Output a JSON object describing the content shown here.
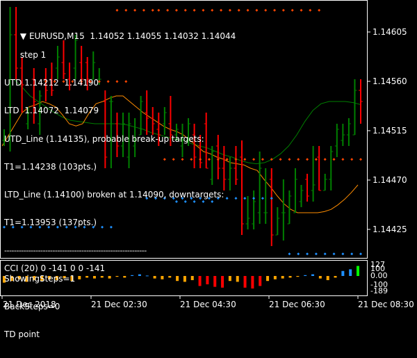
{
  "header": {
    "symbol_line": "EURUSD,M15  1.14052 1.14055 1.14032 1.14044",
    "lines": [
      "step 1",
      "UTD 1.14212  1.14190",
      "LTD  1.14072  1.14079",
      "UTD_Line (1.14135), probable break-up targets:",
      "T1=1.14238 (103pts.)",
      "LTD_Line (1.14100) broken at 1.14090, downtargets:",
      "T1=1.13953 (137pts.)",
      "ShowingSteps=1",
      "BackSteps=0",
      "TD point"
    ]
  },
  "cci": {
    "title": "CCI (20) 0 -141 0 0 -141",
    "levels": [
      "127",
      "100",
      "0.00",
      "-100",
      "-189"
    ]
  },
  "price_axis": [
    "1.14605",
    "1.14560",
    "1.14515",
    "1.14470",
    "1.14425"
  ],
  "time_axis": [
    "21 Dec 2018",
    "21 Dec 02:30",
    "21 Dec 04:30",
    "21 Dec 06:30",
    "21 Dec 08:30"
  ],
  "colors": {
    "bull": "#008000",
    "bear": "#ff0000",
    "ma_orange": "#ff8c00",
    "ma_green": "#008000",
    "dot_red": "#ff4500",
    "dot_blue": "#1e90ff",
    "cci_pos": "#1e90ff",
    "cci_neg": "#ffa500",
    "cci_strong_neg": "#ff0000",
    "cci_strong_pos": "#00ff00"
  },
  "chart_data": {
    "type": "candlestick",
    "ylim": [
      1.144,
      1.1463
    ],
    "candles": [
      {
        "o": 1.14505,
        "h": 1.14515,
        "l": 1.145,
        "c": 1.14508
      },
      {
        "o": 1.14508,
        "h": 1.14625,
        "l": 1.14495,
        "c": 1.146
      },
      {
        "o": 1.146,
        "h": 1.14625,
        "l": 1.1456,
        "c": 1.1457
      },
      {
        "o": 1.1457,
        "h": 1.1458,
        "l": 1.1453,
        "c": 1.14555
      },
      {
        "o": 1.1452,
        "h": 1.14535,
        "l": 1.14515,
        "c": 1.1453
      },
      {
        "o": 1.1456,
        "h": 1.1457,
        "l": 1.1452,
        "c": 1.1454
      },
      {
        "o": 1.1452,
        "h": 1.1455,
        "l": 1.1451,
        "c": 1.14545
      },
      {
        "o": 1.1456,
        "h": 1.1457,
        "l": 1.1454,
        "c": 1.1455
      },
      {
        "o": 1.1456,
        "h": 1.14575,
        "l": 1.14545,
        "c": 1.1455
      },
      {
        "o": 1.1457,
        "h": 1.1459,
        "l": 1.1456,
        "c": 1.1458
      },
      {
        "o": 1.14575,
        "h": 1.14595,
        "l": 1.1456,
        "c": 1.14565
      },
      {
        "o": 1.1456,
        "h": 1.14575,
        "l": 1.1455,
        "c": 1.14555
      },
      {
        "o": 1.1457,
        "h": 1.146,
        "l": 1.1456,
        "c": 1.14595
      },
      {
        "o": 1.14575,
        "h": 1.1459,
        "l": 1.14555,
        "c": 1.1456
      },
      {
        "o": 1.14575,
        "h": 1.1458,
        "l": 1.1455,
        "c": 1.1456
      },
      {
        "o": 1.1456,
        "h": 1.14585,
        "l": 1.1456,
        "c": 1.14575
      },
      {
        "o": 1.1456,
        "h": 1.1457,
        "l": 1.14555,
        "c": 1.1456
      },
      {
        "o": 1.1454,
        "h": 1.1455,
        "l": 1.1448,
        "c": 1.1449
      },
      {
        "o": 1.1454,
        "h": 1.14545,
        "l": 1.1448,
        "c": 1.1454
      },
      {
        "o": 1.1452,
        "h": 1.1453,
        "l": 1.1449,
        "c": 1.145
      },
      {
        "o": 1.145,
        "h": 1.1453,
        "l": 1.1449,
        "c": 1.1452
      },
      {
        "o": 1.1449,
        "h": 1.1453,
        "l": 1.1448,
        "c": 1.1452
      },
      {
        "o": 1.145,
        "h": 1.14525,
        "l": 1.1449,
        "c": 1.14505
      },
      {
        "o": 1.1451,
        "h": 1.14545,
        "l": 1.1451,
        "c": 1.1454
      },
      {
        "o": 1.1453,
        "h": 1.1455,
        "l": 1.1451,
        "c": 1.14525
      },
      {
        "o": 1.14525,
        "h": 1.14535,
        "l": 1.1451,
        "c": 1.1452
      },
      {
        "o": 1.14515,
        "h": 1.1453,
        "l": 1.145,
        "c": 1.1451
      },
      {
        "o": 1.1452,
        "h": 1.14535,
        "l": 1.1451,
        "c": 1.1453
      },
      {
        "o": 1.1452,
        "h": 1.14545,
        "l": 1.145,
        "c": 1.1451
      },
      {
        "o": 1.1451,
        "h": 1.1452,
        "l": 1.14505,
        "c": 1.14515
      },
      {
        "o": 1.145,
        "h": 1.1452,
        "l": 1.1449,
        "c": 1.14505
      },
      {
        "o": 1.14505,
        "h": 1.14525,
        "l": 1.145,
        "c": 1.1452
      },
      {
        "o": 1.1451,
        "h": 1.1452,
        "l": 1.1448,
        "c": 1.1449
      },
      {
        "o": 1.145,
        "h": 1.1451,
        "l": 1.1448,
        "c": 1.14485
      },
      {
        "o": 1.1452,
        "h": 1.1453,
        "l": 1.1448,
        "c": 1.1448
      },
      {
        "o": 1.1447,
        "h": 1.145,
        "l": 1.14465,
        "c": 1.14495
      },
      {
        "o": 1.145,
        "h": 1.1451,
        "l": 1.1447,
        "c": 1.1448
      },
      {
        "o": 1.1448,
        "h": 1.145,
        "l": 1.1446,
        "c": 1.1447
      },
      {
        "o": 1.1447,
        "h": 1.1449,
        "l": 1.1446,
        "c": 1.1448
      },
      {
        "o": 1.1448,
        "h": 1.145,
        "l": 1.14465,
        "c": 1.1447
      },
      {
        "o": 1.1449,
        "h": 1.14505,
        "l": 1.1442,
        "c": 1.1443
      },
      {
        "o": 1.1443,
        "h": 1.14455,
        "l": 1.14425,
        "c": 1.14435
      },
      {
        "o": 1.1443,
        "h": 1.1446,
        "l": 1.14425,
        "c": 1.1445
      },
      {
        "o": 1.1444,
        "h": 1.14495,
        "l": 1.1443,
        "c": 1.1448
      },
      {
        "o": 1.1444,
        "h": 1.1448,
        "l": 1.1443,
        "c": 1.1444
      },
      {
        "o": 1.1447,
        "h": 1.1448,
        "l": 1.1441,
        "c": 1.1442
      },
      {
        "o": 1.1442,
        "h": 1.14445,
        "l": 1.1442,
        "c": 1.14435
      },
      {
        "o": 1.1444,
        "h": 1.1447,
        "l": 1.14415,
        "c": 1.1444
      },
      {
        "o": 1.1443,
        "h": 1.1446,
        "l": 1.1443,
        "c": 1.14455
      },
      {
        "o": 1.1444,
        "h": 1.1448,
        "l": 1.1444,
        "c": 1.1447
      },
      {
        "o": 1.1445,
        "h": 1.14465,
        "l": 1.14445,
        "c": 1.1446
      },
      {
        "o": 1.1447,
        "h": 1.14475,
        "l": 1.1445,
        "c": 1.14455
      },
      {
        "o": 1.1446,
        "h": 1.145,
        "l": 1.1445,
        "c": 1.14465
      },
      {
        "o": 1.1449,
        "h": 1.145,
        "l": 1.1446,
        "c": 1.1446
      },
      {
        "o": 1.1446,
        "h": 1.14475,
        "l": 1.1446,
        "c": 1.1447
      },
      {
        "o": 1.1447,
        "h": 1.145,
        "l": 1.1446,
        "c": 1.14495
      },
      {
        "o": 1.145,
        "h": 1.1452,
        "l": 1.1449,
        "c": 1.14515
      },
      {
        "o": 1.14505,
        "h": 1.1452,
        "l": 1.145,
        "c": 1.1451
      },
      {
        "o": 1.1451,
        "h": 1.14525,
        "l": 1.145,
        "c": 1.1452
      },
      {
        "o": 1.1451,
        "h": 1.1456,
        "l": 1.1451,
        "c": 1.1455
      },
      {
        "o": 1.1455,
        "h": 1.1456,
        "l": 1.1452,
        "c": 1.1454
      }
    ],
    "ma_orange": [
      1.145,
      1.1451,
      1.1452,
      1.1453,
      1.14535,
      1.14537,
      1.1454,
      1.14538,
      1.14535,
      1.14528,
      1.1452,
      1.14518,
      1.1452,
      1.1453,
      1.14538,
      1.1454,
      1.14543,
      1.14545,
      1.14545,
      1.1454,
      1.14535,
      1.1453,
      1.14526,
      1.14522,
      1.14518,
      1.14515,
      1.14513,
      1.1451,
      1.14505,
      1.145,
      1.14495,
      1.14493,
      1.1449,
      1.14488,
      1.14485,
      1.14484,
      1.14483,
      1.1448,
      1.14478,
      1.1447,
      1.14463,
      1.14455,
      1.14448,
      1.14443,
      1.1444,
      1.1444,
      1.1444,
      1.1444,
      1.14441,
      1.14443,
      1.14447,
      1.14452,
      1.14458,
      1.14465
    ],
    "ma_green": [
      1.1456,
      1.14553,
      1.14545,
      1.1454,
      1.14535,
      1.1453,
      1.14526,
      1.14523,
      1.14522,
      1.14521,
      1.1452,
      1.1452,
      1.1452,
      1.1452,
      1.14519,
      1.14517,
      1.14515,
      1.14512,
      1.1451,
      1.14508,
      1.14506,
      1.14505,
      1.14502,
      1.145,
      1.14498,
      1.14495,
      1.14492,
      1.1449,
      1.14487,
      1.14485,
      1.14484,
      1.14485,
      1.14488,
      1.14493,
      1.145,
      1.1451,
      1.14522,
      1.14532,
      1.14538,
      1.1454,
      1.1454,
      1.1454,
      1.14539,
      1.14537
    ],
    "dot_rows": [
      {
        "price": 1.14622,
        "from": 19,
        "to": 26,
        "color": "red"
      },
      {
        "price": 1.14622,
        "from": 26,
        "to": 53,
        "color": "red"
      },
      {
        "price": 1.14558,
        "from": 7,
        "to": 21,
        "color": "red"
      },
      {
        "price": 1.14488,
        "from": 27,
        "to": 60,
        "color": "red"
      },
      {
        "price": 1.14453,
        "from": 24,
        "to": 45,
        "color": "blue"
      },
      {
        "price": 1.1445,
        "from": 29,
        "to": 35,
        "color": "blue"
      },
      {
        "price": 1.14427,
        "from": 0,
        "to": 18,
        "color": "blue"
      },
      {
        "price": 1.14403,
        "from": 48,
        "to": 61,
        "color": "blue"
      }
    ],
    "cci": [
      -80,
      -60,
      -40,
      -70,
      -50,
      -60,
      -40,
      -50,
      -30,
      -60,
      -40,
      -20,
      -30,
      -20,
      -30,
      -10,
      -20,
      10,
      20,
      5,
      -30,
      -40,
      -20,
      -60,
      -70,
      -50,
      -120,
      -100,
      -130,
      -140,
      -60,
      -70,
      -140,
      -150,
      -120,
      -60,
      -40,
      -30,
      -20,
      -10,
      10,
      20,
      -30,
      -50,
      -20,
      60,
      80,
      120
    ]
  }
}
